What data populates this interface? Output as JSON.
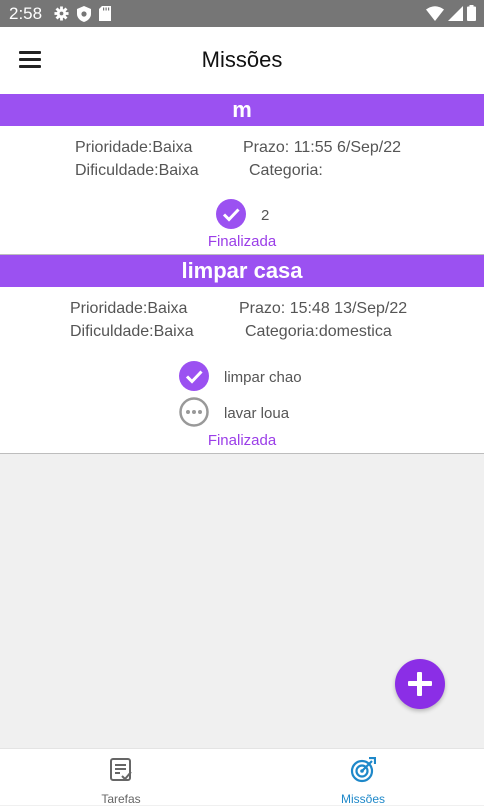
{
  "status_bar": {
    "time": "2:58"
  },
  "app_bar": {
    "title": "Missões"
  },
  "missions": [
    {
      "title": "m",
      "prioridade": "Prioridade:Baixa",
      "prazo": "Prazo: 11:55 6/Sep/22",
      "dificuldade": "Dificuldade:Baixa",
      "categoria": "Categoria:",
      "tasks": [
        {
          "label": "2",
          "done": true
        }
      ],
      "status": "Finalizada"
    },
    {
      "title": "limpar casa",
      "prioridade": "Prioridade:Baixa",
      "prazo": "Prazo: 15:48 13/Sep/22",
      "dificuldade": "Dificuldade:Baixa",
      "categoria": "Categoria:domestica",
      "tasks": [
        {
          "label": "limpar chao",
          "done": true
        },
        {
          "label": "lavar loua",
          "done": false
        }
      ],
      "status": "Finalizada"
    }
  ],
  "bottom_nav": {
    "items": [
      {
        "label": "Tarefas",
        "icon": "task-list-icon",
        "active": false
      },
      {
        "label": "Missões",
        "icon": "target-icon",
        "active": true
      }
    ]
  },
  "colors": {
    "accent": "#9b51f1",
    "fab": "#8b2ee6",
    "active_nav": "#1e88c9",
    "inactive_nav": "#666666",
    "status_bar": "#767676"
  }
}
